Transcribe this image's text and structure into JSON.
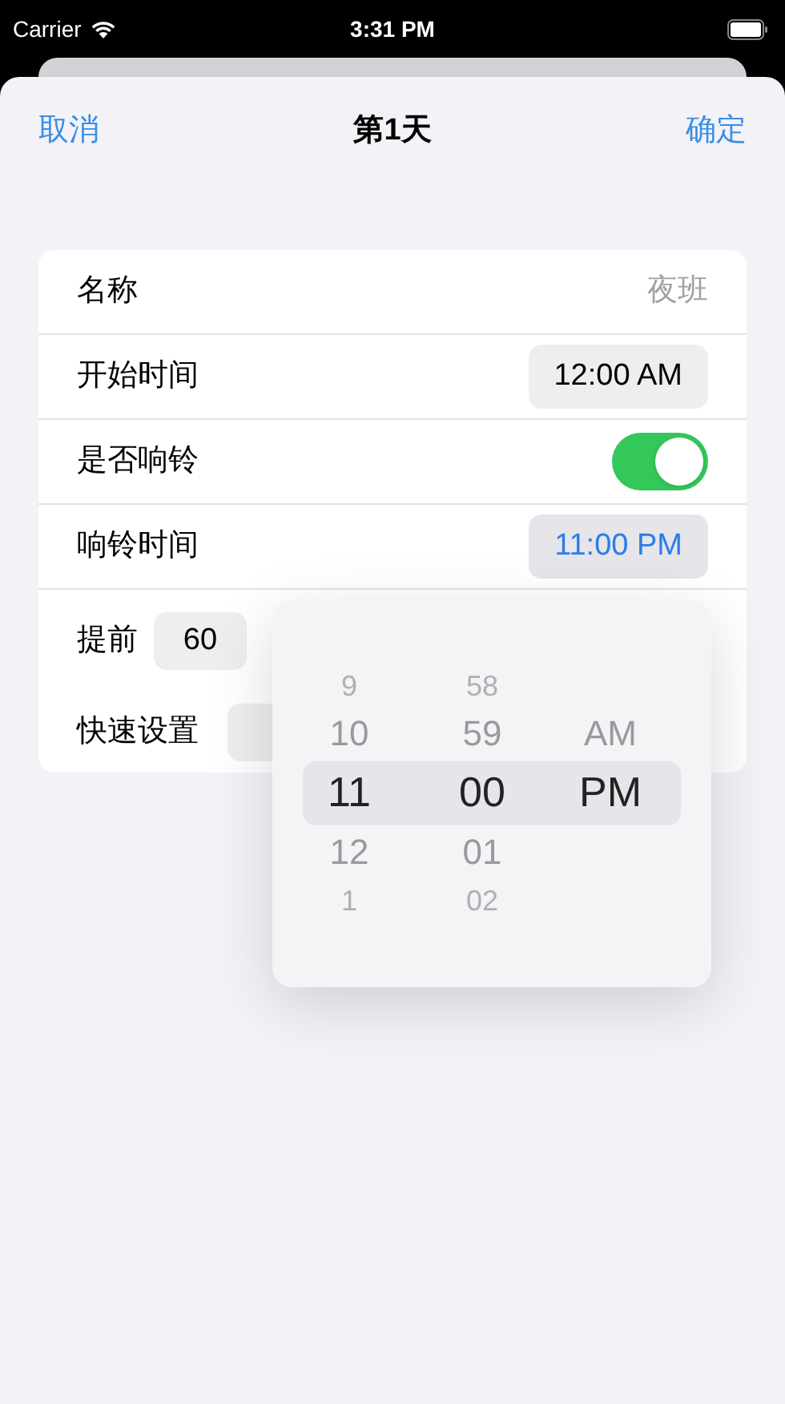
{
  "status_bar": {
    "carrier": "Carrier",
    "time": "3:31 PM"
  },
  "nav": {
    "cancel": "取消",
    "title": "第1天",
    "confirm": "确定"
  },
  "form": {
    "rows": [
      {
        "kind": "value",
        "label": "名称",
        "value": "夜班"
      },
      {
        "kind": "time",
        "label": "开始时间",
        "value": "12:00 AM",
        "selected": false
      },
      {
        "kind": "toggle",
        "label": "是否响铃",
        "on": true
      },
      {
        "kind": "time",
        "label": "响铃时间",
        "value": "11:00 PM",
        "selected": true
      },
      {
        "kind": "stepper",
        "label": "提前",
        "value": "60"
      },
      {
        "kind": "quick",
        "label": "快速设置"
      }
    ]
  },
  "time_picker": {
    "columns": [
      {
        "items": [
          {
            "text": "9",
            "selected": false
          },
          {
            "text": "10",
            "selected": false
          },
          {
            "text": "11",
            "selected": true
          },
          {
            "text": "12",
            "selected": false
          },
          {
            "text": "1",
            "selected": false
          }
        ]
      },
      {
        "items": [
          {
            "text": "58",
            "selected": false
          },
          {
            "text": "59",
            "selected": false
          },
          {
            "text": "00",
            "selected": true
          },
          {
            "text": "01",
            "selected": false
          },
          {
            "text": "02",
            "selected": false
          }
        ]
      },
      {
        "items": [
          {
            "text": "AM",
            "selected": false
          },
          {
            "text": "PM",
            "selected": true
          }
        ]
      }
    ]
  }
}
